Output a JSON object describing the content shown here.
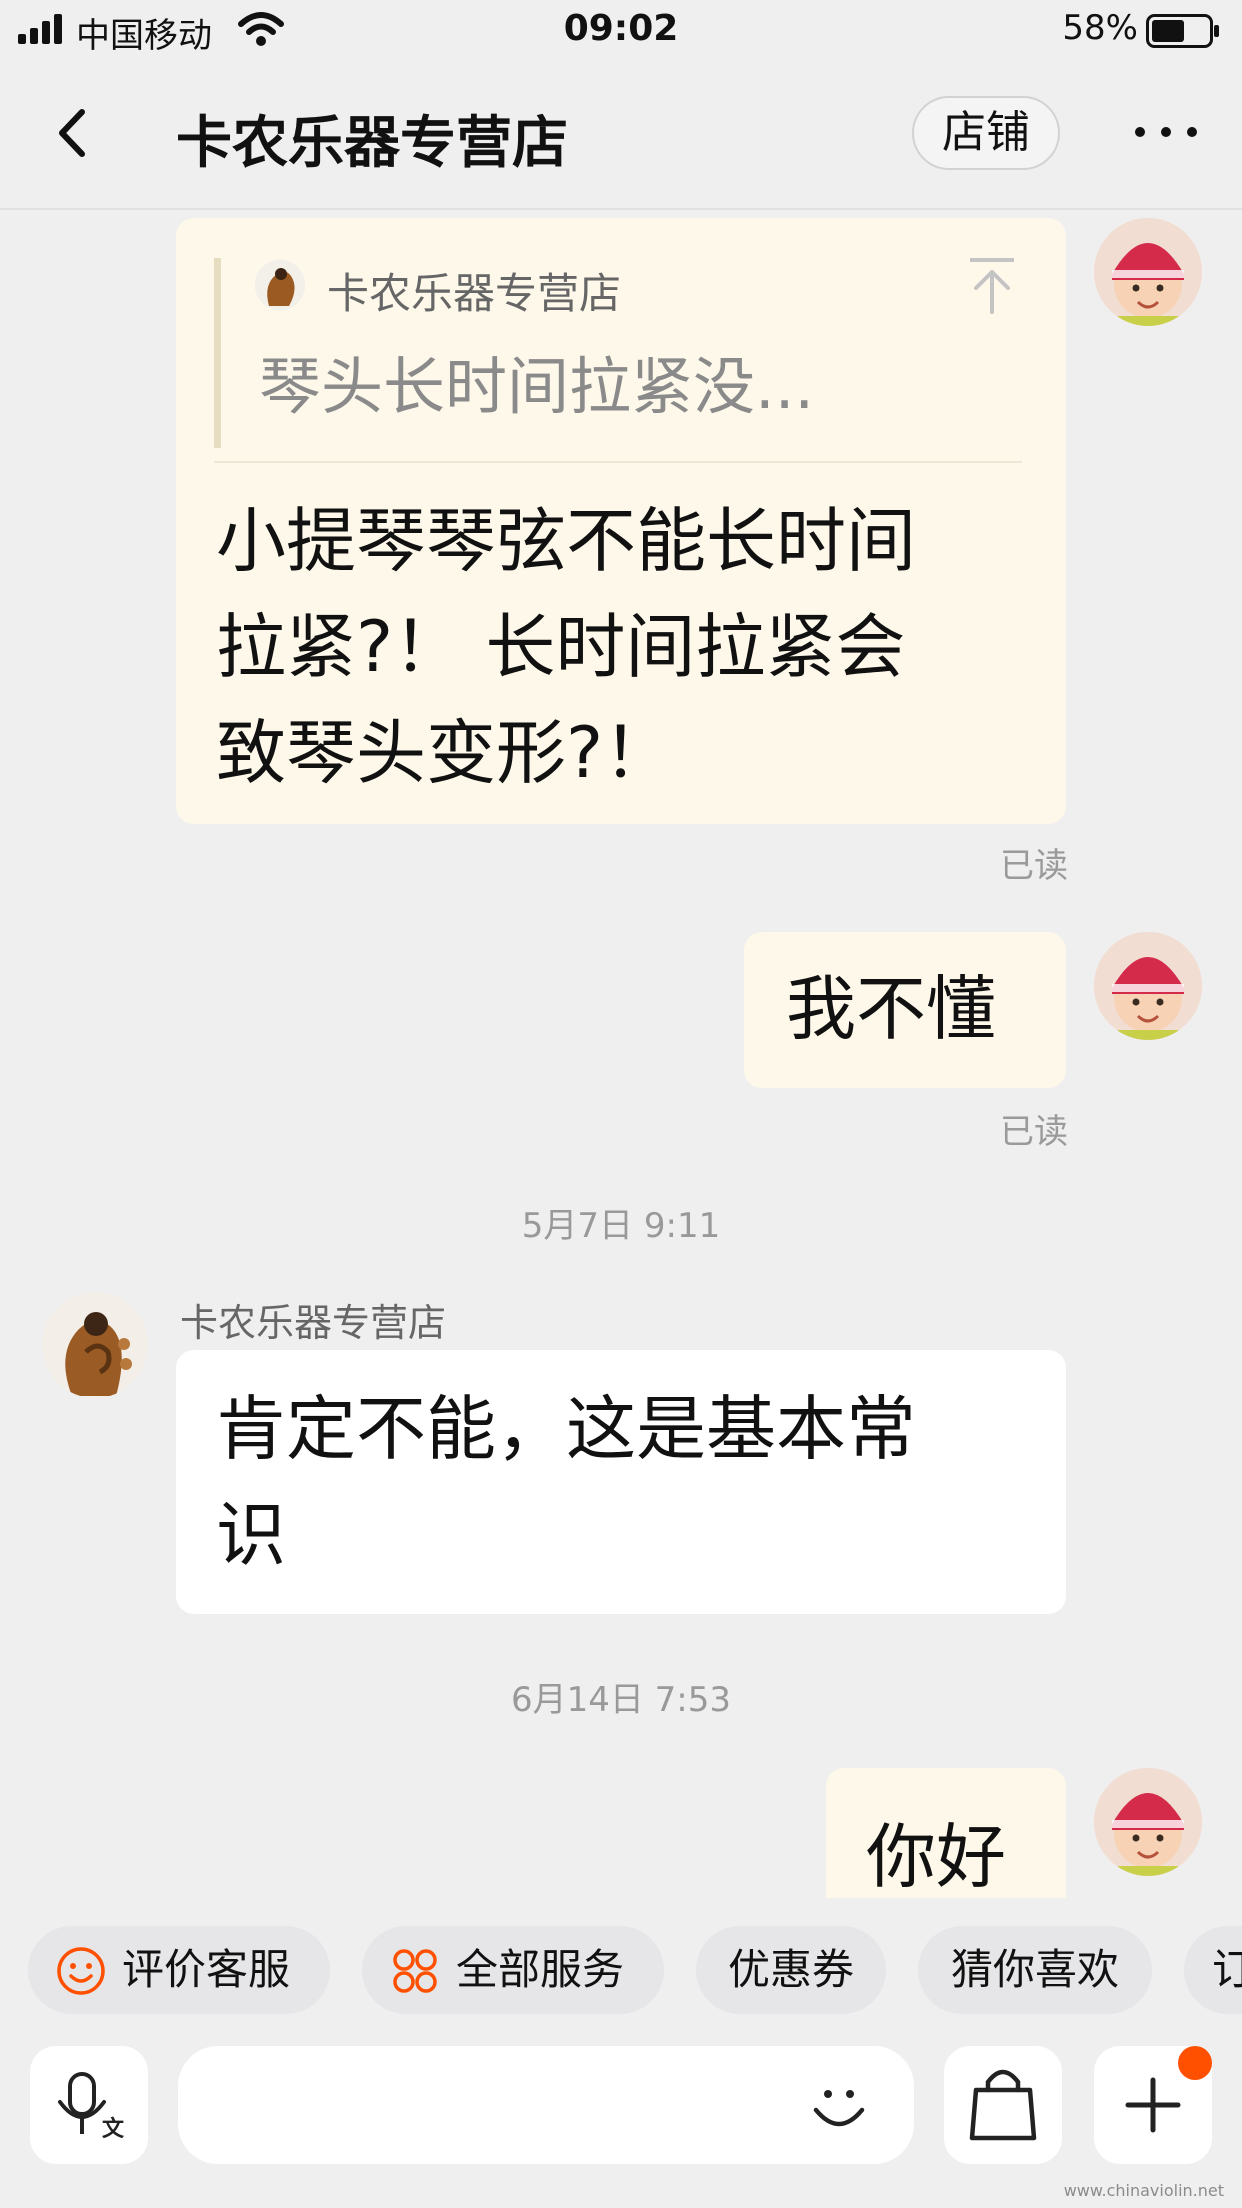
{
  "status_bar": {
    "carrier": "中国移动",
    "time": "09:02",
    "battery_percent": "58%",
    "battery_level": 0.58
  },
  "nav": {
    "title": "卡农乐器专营店",
    "shop_button": "店铺",
    "back_icon": "chevron-left-icon",
    "more_icon": "more-dots-icon"
  },
  "messages": {
    "m1": {
      "quote_name": "卡农乐器专营店",
      "quote_text": "琴头长时间拉紧没...",
      "lines": [
        "小提琴琴弦不能长时间",
        "拉紧?！ 长时间拉紧会",
        "致琴头变形?！"
      ],
      "status": "已读"
    },
    "m2": {
      "text": "我不懂",
      "status": "已读"
    },
    "ts1": "5月7日 9:11",
    "m3": {
      "sender": "卡农乐器专营店",
      "lines": [
        "肯定不能，这是基本常",
        "识"
      ]
    },
    "ts2": "6月14日 7:53",
    "m4": {
      "text": "你好"
    }
  },
  "quick_actions": [
    {
      "label": "评价客服",
      "icon": "smiley-icon"
    },
    {
      "label": "全部服务",
      "icon": "four-circles-icon"
    },
    {
      "label": "优惠券"
    },
    {
      "label": "猜你喜欢"
    },
    {
      "label": "订"
    }
  ],
  "input_bar": {
    "voice_icon": "voice-translate-icon",
    "emoji_icon": "smiley-face-icon",
    "cart_icon": "shopping-bag-icon",
    "plus_icon": "plus-icon"
  },
  "watermark": "www.chinaviolin.net",
  "colors": {
    "accent": "#ff5000",
    "outgoing_bubble": "#fdf8ea",
    "incoming_bubble": "#ffffff",
    "background": "#efeff0"
  }
}
